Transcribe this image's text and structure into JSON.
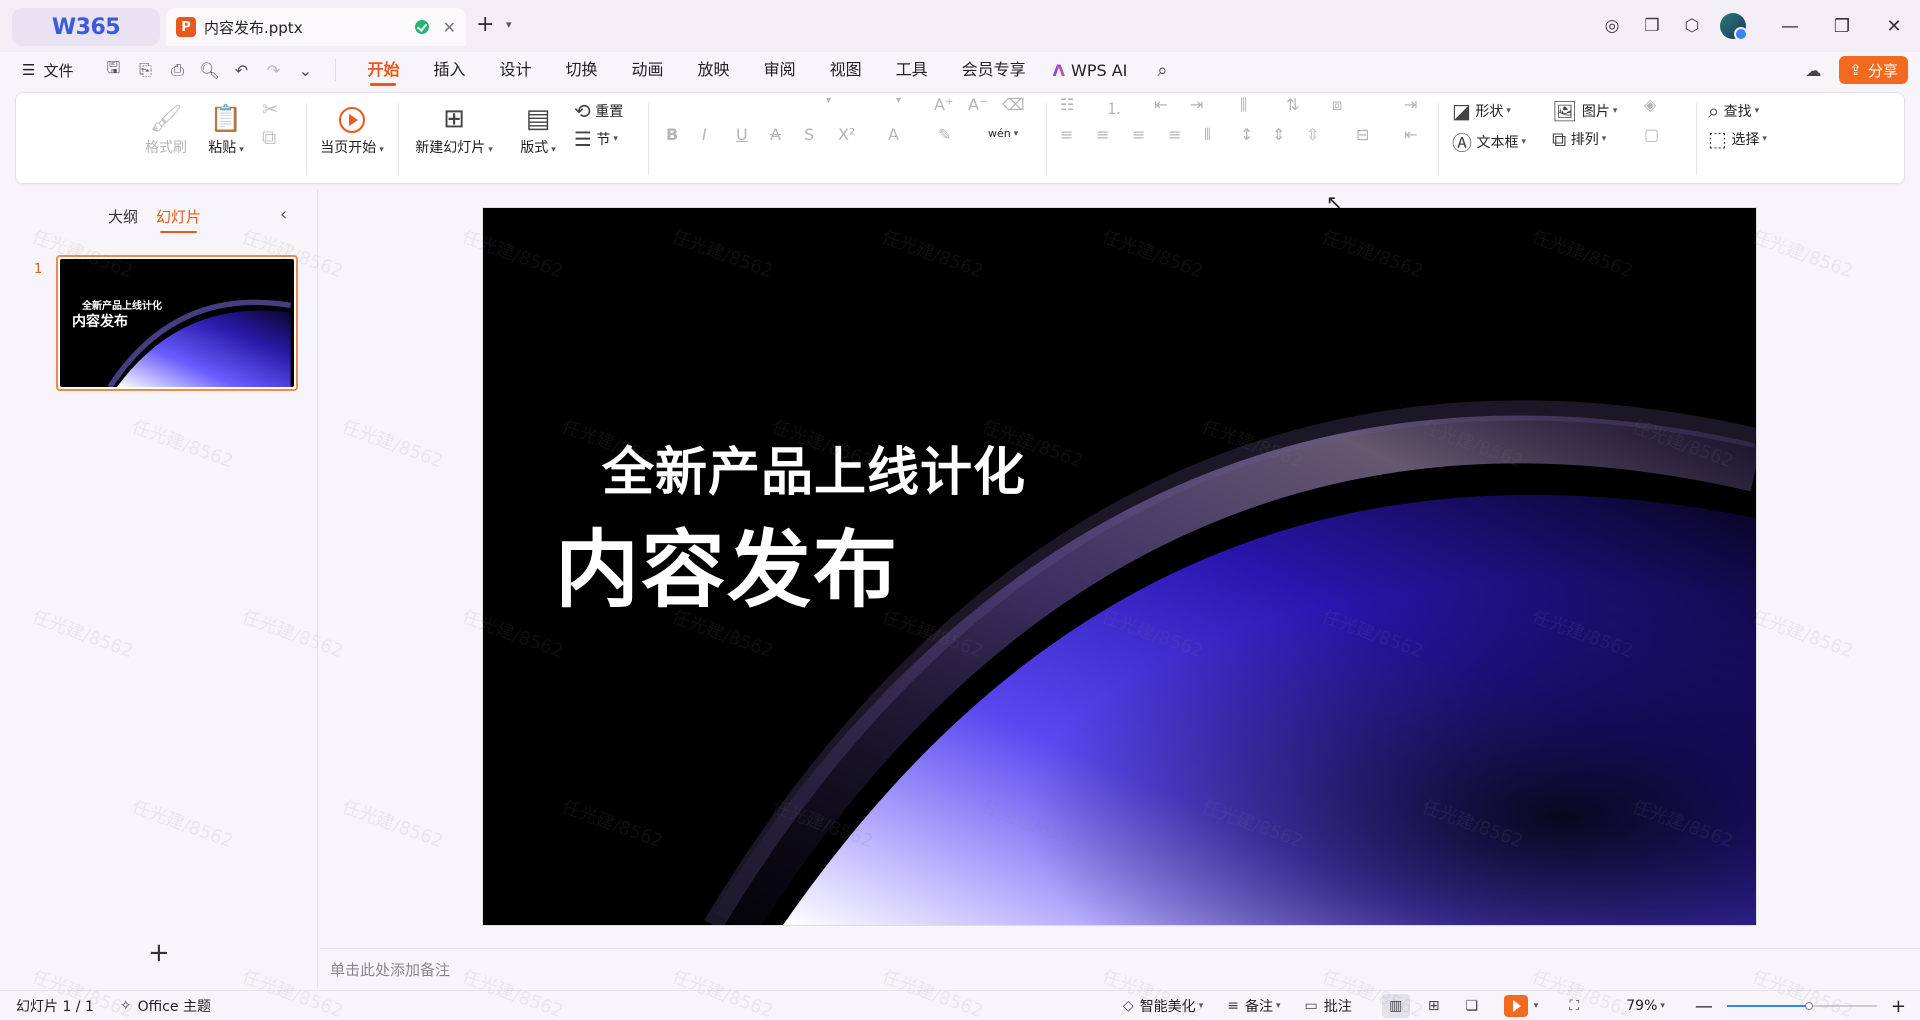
{
  "titlebar": {
    "logo": "W365",
    "tab_badge": "P",
    "doc_name": "内容发布.pptx",
    "tab_close": "✕",
    "new_tab": "+",
    "new_tab_chevron": "⌄"
  },
  "menu": {
    "file_label": "文件",
    "tabs": [
      "开始",
      "插入",
      "设计",
      "切换",
      "动画",
      "放映",
      "审阅",
      "视图",
      "工具",
      "会员专享"
    ],
    "active_tab": "开始",
    "ai_label": "WPS AI",
    "share_label": "分享"
  },
  "ribbon": {
    "format_painter": "格式刷",
    "paste": "粘贴",
    "from_current": "当页开始",
    "new_slide": "新建幻灯片",
    "layout": "版式",
    "section": "节",
    "reset": "重置",
    "shape": "形状",
    "picture": "图片",
    "textbox": "文本框",
    "arrange": "排列",
    "find": "查找",
    "select": "选择",
    "phonetic": "wén"
  },
  "left_panel": {
    "tab_outline": "大纲",
    "tab_slides": "幻灯片",
    "slide_number": "1",
    "thumb_subtitle": "全新产品上线计化",
    "thumb_title": "内容发布",
    "add_slide": "+"
  },
  "slide": {
    "subtitle": "全新产品上线计化",
    "title": "内容发布"
  },
  "notes": {
    "placeholder": "单击此处添加备注"
  },
  "statusbar": {
    "slide_count": "幻灯片 1 / 1",
    "theme": "Office 主题",
    "beautify": "智能美化",
    "notes": "备注",
    "comments": "批注",
    "zoom": "79%",
    "zoom_level": 0.55
  },
  "watermark": "任光建/8562",
  "colors": {
    "accent": "#e85a19",
    "share_button": "#f26a1f",
    "sync_ok": "#22b573",
    "logo": "#3b5bdb"
  },
  "icons": {
    "sync": "check-circle-icon",
    "search": "search-icon",
    "cloud": "cloud-icon",
    "avatar": "user-avatar"
  }
}
